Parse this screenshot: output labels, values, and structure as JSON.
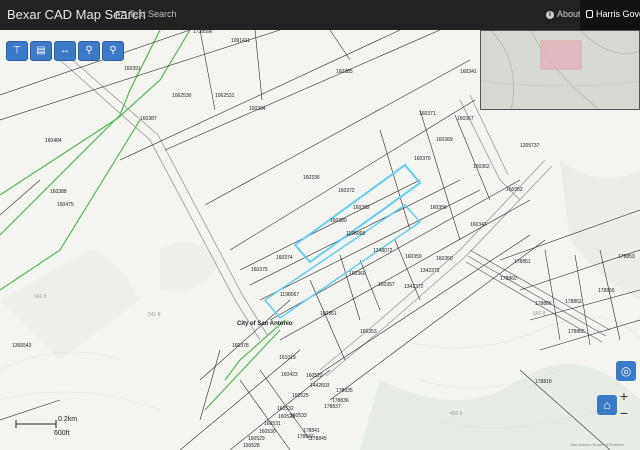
{
  "navbar": {
    "brand": "Bexar CAD Map Search",
    "text_search": "Text Search",
    "about": "About",
    "harris": "Harris Govern"
  },
  "toolbar": {
    "tools": [
      "layers-icon",
      "map-icon",
      "measure-icon",
      "location-pin-icon",
      "search-icon"
    ]
  },
  "map": {
    "city_label": "City of San Antonio",
    "highlight_color": "#66ccee",
    "parcels": [
      "1091411",
      "1738596",
      "160391",
      "1062530",
      "1062531",
      "160387",
      "160384",
      "160385",
      "160341",
      "160484",
      "160388",
      "160475",
      "160371",
      "160369",
      "160367",
      "160370",
      "160362",
      "1205737",
      "160336",
      "160372",
      "160382",
      "160352",
      "160356",
      "160380",
      "1198068",
      "160347",
      "160374",
      "1248072",
      "160359",
      "160350",
      "160375",
      "160360",
      "1342373",
      "160357",
      "1342372",
      "1198067",
      "160361",
      "160353",
      "160378",
      "1366543",
      "178861",
      "178860",
      "178853",
      "178856",
      "178862",
      "178866",
      "178865",
      "178818",
      "161019",
      "160423",
      "160522",
      "1442603",
      "178835",
      "160525",
      "160532",
      "178836",
      "178837",
      "160531",
      "160530",
      "160529",
      "160528",
      "160523",
      "160533",
      "178841",
      "178842",
      "178845"
    ],
    "faint_labels": [
      "541 ft",
      "541 ft",
      "450 ft",
      "660 ft"
    ]
  },
  "scale": {
    "km": "0.2km",
    "ft": "600ft"
  },
  "controls": {
    "zoom_in": "+",
    "zoom_out": "−"
  },
  "attribution": "San Antonio Board of Realtors"
}
